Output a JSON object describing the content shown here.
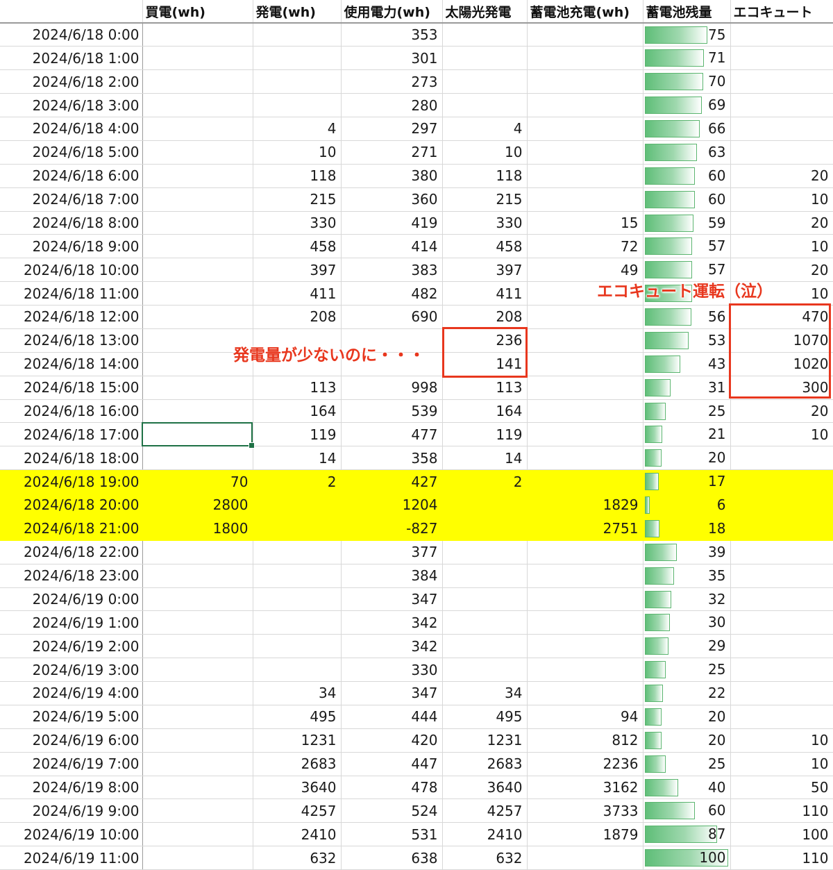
{
  "headers": [
    "",
    "買電(wh)",
    "発電(wh)",
    "使用電力(wh)",
    "太陽光発電",
    "蓄電池充電(wh)",
    "蓄電池残量",
    "エコキュート"
  ],
  "colors": {
    "highlight": "#ffff00",
    "annotation": "#e8371e",
    "bar": "#5fbe78",
    "selection": "#1e7145"
  },
  "rows": [
    [
      "2024/6/18 0:00",
      "",
      "",
      "353",
      "",
      "",
      "75",
      ""
    ],
    [
      "2024/6/18 1:00",
      "",
      "",
      "301",
      "",
      "",
      "71",
      ""
    ],
    [
      "2024/6/18 2:00",
      "",
      "",
      "273",
      "",
      "",
      "70",
      ""
    ],
    [
      "2024/6/18 3:00",
      "",
      "",
      "280",
      "",
      "",
      "69",
      ""
    ],
    [
      "2024/6/18 4:00",
      "",
      "4",
      "297",
      "4",
      "",
      "66",
      ""
    ],
    [
      "2024/6/18 5:00",
      "",
      "10",
      "271",
      "10",
      "",
      "63",
      ""
    ],
    [
      "2024/6/18 6:00",
      "",
      "118",
      "380",
      "118",
      "",
      "60",
      "20"
    ],
    [
      "2024/6/18 7:00",
      "",
      "215",
      "360",
      "215",
      "",
      "60",
      "10"
    ],
    [
      "2024/6/18 8:00",
      "",
      "330",
      "419",
      "330",
      "15",
      "59",
      "20"
    ],
    [
      "2024/6/18 9:00",
      "",
      "458",
      "414",
      "458",
      "72",
      "57",
      "10"
    ],
    [
      "2024/6/18 10:00",
      "",
      "397",
      "383",
      "397",
      "49",
      "57",
      "20"
    ],
    [
      "2024/6/18 11:00",
      "",
      "411",
      "482",
      "411",
      "",
      "",
      "10"
    ],
    [
      "2024/6/18 12:00",
      "",
      "208",
      "690",
      "208",
      "",
      "56",
      "470"
    ],
    [
      "2024/6/18 13:00",
      "",
      "",
      "",
      "236",
      "",
      "53",
      "1070"
    ],
    [
      "2024/6/18 14:00",
      "",
      "",
      "",
      "141",
      "",
      "43",
      "1020"
    ],
    [
      "2024/6/18 15:00",
      "",
      "113",
      "998",
      "113",
      "",
      "31",
      "300"
    ],
    [
      "2024/6/18 16:00",
      "",
      "164",
      "539",
      "164",
      "",
      "25",
      "20"
    ],
    [
      "2024/6/18 17:00",
      "",
      "119",
      "477",
      "119",
      "",
      "21",
      "10"
    ],
    [
      "2024/6/18 18:00",
      "",
      "14",
      "358",
      "14",
      "",
      "20",
      ""
    ],
    [
      "2024/6/18 19:00",
      "70",
      "2",
      "427",
      "2",
      "",
      "17",
      ""
    ],
    [
      "2024/6/18 20:00",
      "2800",
      "",
      "1204",
      "",
      "1829",
      "6",
      ""
    ],
    [
      "2024/6/18 21:00",
      "1800",
      "",
      "-827",
      "",
      "2751",
      "18",
      ""
    ],
    [
      "2024/6/18 22:00",
      "",
      "",
      "377",
      "",
      "",
      "39",
      ""
    ],
    [
      "2024/6/18 23:00",
      "",
      "",
      "384",
      "",
      "",
      "35",
      ""
    ],
    [
      "2024/6/19 0:00",
      "",
      "",
      "347",
      "",
      "",
      "32",
      ""
    ],
    [
      "2024/6/19 1:00",
      "",
      "",
      "342",
      "",
      "",
      "30",
      ""
    ],
    [
      "2024/6/19 2:00",
      "",
      "",
      "342",
      "",
      "",
      "29",
      ""
    ],
    [
      "2024/6/19 3:00",
      "",
      "",
      "330",
      "",
      "",
      "25",
      ""
    ],
    [
      "2024/6/19 4:00",
      "",
      "34",
      "347",
      "34",
      "",
      "22",
      ""
    ],
    [
      "2024/6/19 5:00",
      "",
      "495",
      "444",
      "495",
      "94",
      "20",
      ""
    ],
    [
      "2024/6/19 6:00",
      "",
      "1231",
      "420",
      "1231",
      "812",
      "20",
      "10"
    ],
    [
      "2024/6/19 7:00",
      "",
      "2683",
      "447",
      "2683",
      "2236",
      "25",
      "10"
    ],
    [
      "2024/6/19 8:00",
      "",
      "3640",
      "478",
      "3640",
      "3162",
      "40",
      "50"
    ],
    [
      "2024/6/19 9:00",
      "",
      "4257",
      "524",
      "4257",
      "3733",
      "60",
      "110"
    ],
    [
      "2024/6/19 10:00",
      "",
      "2410",
      "531",
      "2410",
      "1879",
      "87",
      "100"
    ],
    [
      "2024/6/19 11:00",
      "",
      "632",
      "638",
      "632",
      "",
      "100",
      "110"
    ]
  ],
  "bar_levels": [
    75,
    71,
    70,
    69,
    66,
    63,
    60,
    60,
    59,
    57,
    57,
    57,
    56,
    53,
    43,
    31,
    25,
    21,
    20,
    17,
    6,
    18,
    39,
    35,
    32,
    30,
    29,
    25,
    22,
    20,
    20,
    25,
    40,
    60,
    87,
    100
  ],
  "highlight_rows": [
    19,
    20,
    21
  ],
  "annotations": {
    "ecocute": "エコキュート運転（泣）",
    "generation": "発電量が少ないのに・・・"
  }
}
